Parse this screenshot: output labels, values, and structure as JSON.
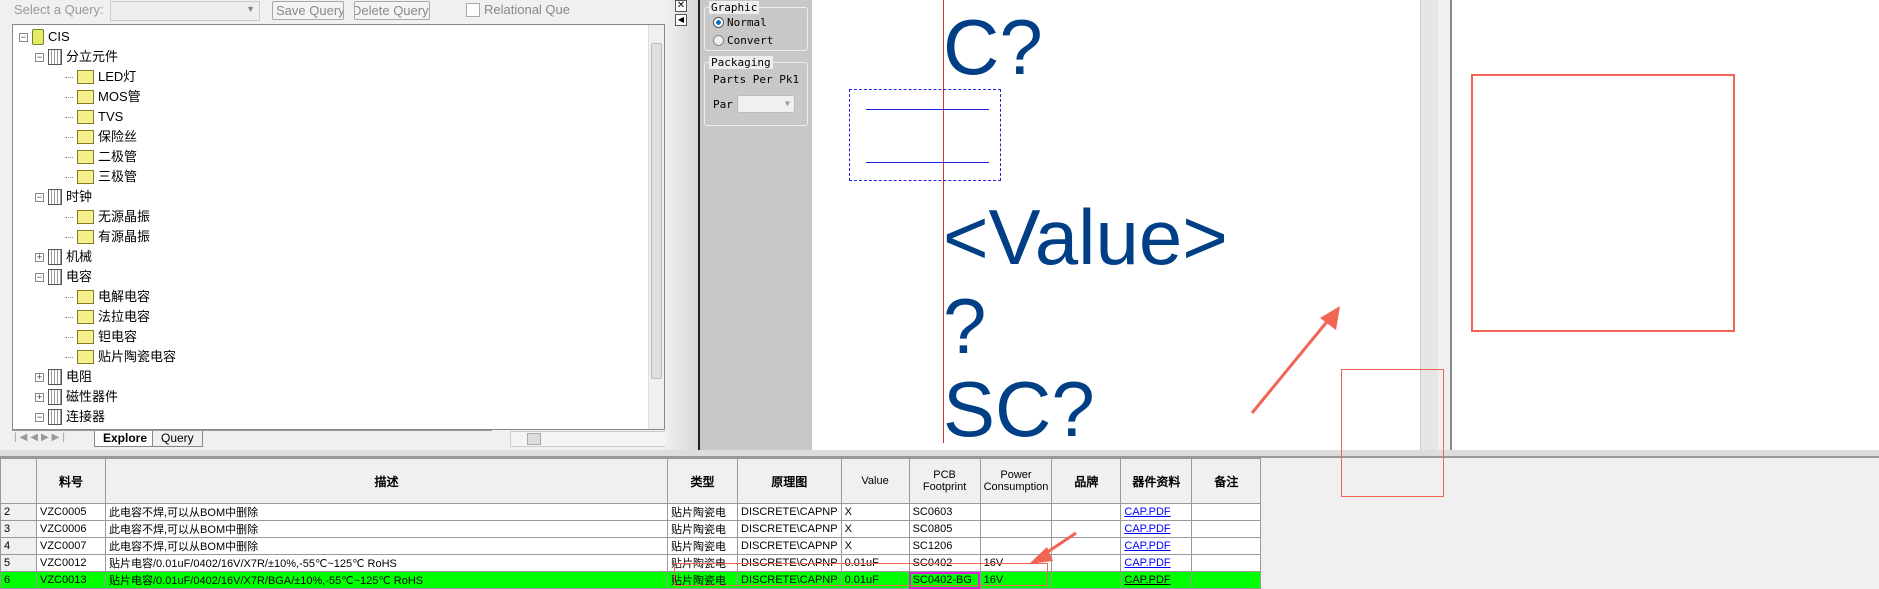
{
  "toolbar": {
    "query_label": "Select a Query:",
    "save_query": "Save Query",
    "delete_query": "Delete Query",
    "relational": "Relational Que"
  },
  "tree": {
    "root": "CIS",
    "groups": [
      {
        "label": "分立元件",
        "expanded": true,
        "children": [
          "LED灯",
          "MOS管",
          "TVS",
          "保险丝",
          "二极管",
          "三极管"
        ]
      },
      {
        "label": "时钟",
        "expanded": true,
        "children": [
          "无源晶振",
          "有源晶振"
        ]
      },
      {
        "label": "机械",
        "expanded": false,
        "children": []
      },
      {
        "label": "电容",
        "expanded": true,
        "children": [
          "电解电容",
          "法拉电容",
          "钽电容",
          "贴片陶瓷电容"
        ]
      },
      {
        "label": "电阻",
        "expanded": false,
        "children": []
      },
      {
        "label": "磁性器件",
        "expanded": false,
        "children": []
      },
      {
        "label": "连接器",
        "expanded": true,
        "children": []
      }
    ]
  },
  "tabs": {
    "explore": "Explore",
    "query": "Query"
  },
  "props": {
    "graphic": "Graphic",
    "normal": "Normal",
    "convert": "Convert",
    "packaging": "Packaging",
    "parts_per_pkg": "Parts Per Pk",
    "parts_per_pkg_value": "1",
    "part": "Par"
  },
  "canvas": {
    "ref": "C?",
    "value": "<Value>",
    "q": "?",
    "footprint": "SC?"
  },
  "table": {
    "headers": [
      "",
      "料号",
      "描述",
      "类型",
      "原理图",
      "Value",
      "PCB Footprint",
      "Power Consumption",
      "品牌",
      "器件资料",
      "备注"
    ],
    "rows": [
      [
        "2",
        "VZC0005",
        "此电容不焊,可以从BOM中删除",
        "贴片陶瓷电",
        "DISCRETE\\CAPNP",
        "X",
        "SC0603",
        "",
        "",
        "CAP.PDF",
        ""
      ],
      [
        "3",
        "VZC0006",
        "此电容不焊,可以从BOM中删除",
        "贴片陶瓷电",
        "DISCRETE\\CAPNP",
        "X",
        "SC0805",
        "",
        "",
        "CAP.PDF",
        ""
      ],
      [
        "4",
        "VZC0007",
        "此电容不焊,可以从BOM中删除",
        "贴片陶瓷电",
        "DISCRETE\\CAPNP",
        "X",
        "SC1206",
        "",
        "",
        "CAP.PDF",
        ""
      ],
      [
        "5",
        "VZC0012",
        "贴片电容/0.01uF/0402/16V/X7R/±10%,-55℃~125℃ RoHS",
        "贴片陶瓷电",
        "DISCRETE\\CAPNP",
        "0.01uF",
        "SC0402",
        "16V",
        "",
        "CAP.PDF",
        ""
      ],
      [
        "6",
        "VZC0013",
        "贴片电容/0.01uF/0402/16V/X7R/BGA/±10%,-55℃~125℃ RoHS",
        "贴片陶瓷电",
        "DISCRETE\\CAPNP",
        "0.01uF",
        "SC0402-BG",
        "16V",
        "",
        "CAP.PDF",
        ""
      ]
    ],
    "selected_row": 4
  },
  "colors": {
    "selected": "#00ff00",
    "annotation": "#f26555",
    "text_blue": "#003f85"
  }
}
